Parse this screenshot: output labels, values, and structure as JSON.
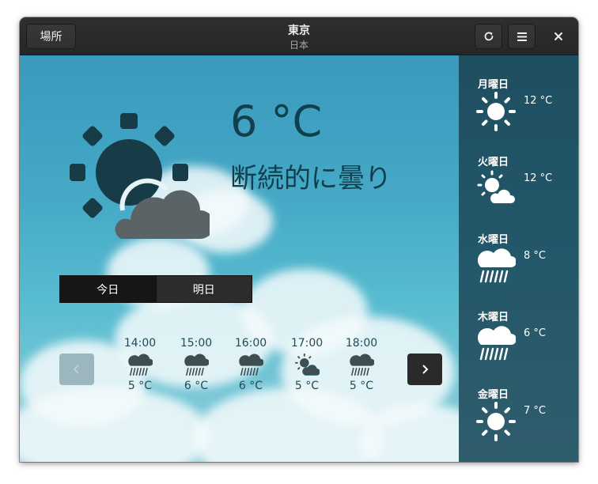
{
  "header": {
    "places_label": "場所",
    "title": "東京",
    "subtitle": "日本",
    "refresh_icon": "refresh-icon",
    "menu_icon": "hamburger-menu-icon",
    "close_icon": "close-icon"
  },
  "current": {
    "temperature": "6 °C",
    "condition": "断続的に曇り",
    "icon": "sun-behind-cloud-icon"
  },
  "tabs": [
    {
      "label": "今日",
      "selected": true
    },
    {
      "label": "明日",
      "selected": false
    }
  ],
  "hourly": [
    {
      "time": "14:00",
      "temp": "5 °C",
      "icon": "rain-icon"
    },
    {
      "time": "15:00",
      "temp": "6 °C",
      "icon": "rain-icon"
    },
    {
      "time": "16:00",
      "temp": "6 °C",
      "icon": "rain-icon"
    },
    {
      "time": "17:00",
      "temp": "5 °C",
      "icon": "partly-cloudy-icon"
    },
    {
      "time": "18:00",
      "temp": "5 °C",
      "icon": "rain-icon"
    }
  ],
  "forecast": [
    {
      "day": "月曜日",
      "temp": "12 °C",
      "icon": "sun-icon"
    },
    {
      "day": "火曜日",
      "temp": "12 °C",
      "icon": "partly-cloudy-icon"
    },
    {
      "day": "水曜日",
      "temp": "8 °C",
      "icon": "rain-icon"
    },
    {
      "day": "木曜日",
      "temp": "6 °C",
      "icon": "rain-icon"
    },
    {
      "day": "金曜日",
      "temp": "7 °C",
      "icon": "sun-icon"
    }
  ],
  "colors": {
    "sky": "#45a9c6",
    "text_dark": "#113f4d",
    "sidebar": "#23576a"
  }
}
